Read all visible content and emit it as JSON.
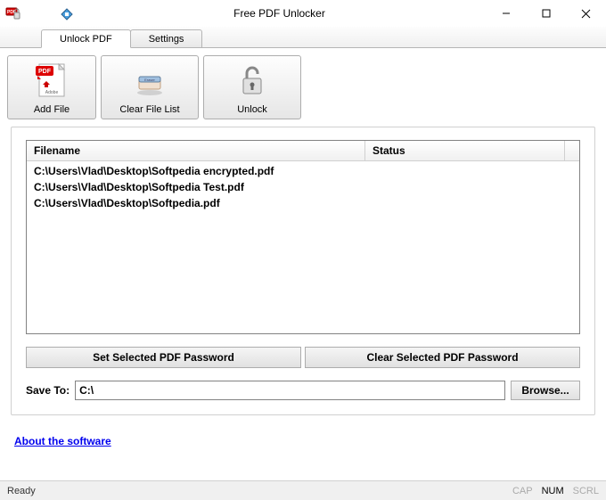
{
  "window": {
    "title": "Free PDF Unlocker"
  },
  "tabs": {
    "unlock": "Unlock PDF",
    "settings": "Settings"
  },
  "toolbar": {
    "add_file": "Add File",
    "clear_list": "Clear File List",
    "unlock": "Unlock"
  },
  "list": {
    "col_filename": "Filename",
    "col_status": "Status",
    "rows": [
      {
        "filename": "C:\\Users\\Vlad\\Desktop\\Softpedia encrypted.pdf",
        "status": ""
      },
      {
        "filename": "C:\\Users\\Vlad\\Desktop\\Softpedia Test.pdf",
        "status": ""
      },
      {
        "filename": "C:\\Users\\Vlad\\Desktop\\Softpedia.pdf",
        "status": ""
      }
    ]
  },
  "buttons": {
    "set_pw": "Set Selected PDF Password",
    "clear_pw": "Clear Selected PDF Password",
    "browse": "Browse..."
  },
  "save": {
    "label": "Save To:",
    "value": "C:\\"
  },
  "link": {
    "about": "About the software"
  },
  "status": {
    "ready": "Ready",
    "cap": "CAP",
    "num": "NUM",
    "scrl": "SCRL"
  }
}
